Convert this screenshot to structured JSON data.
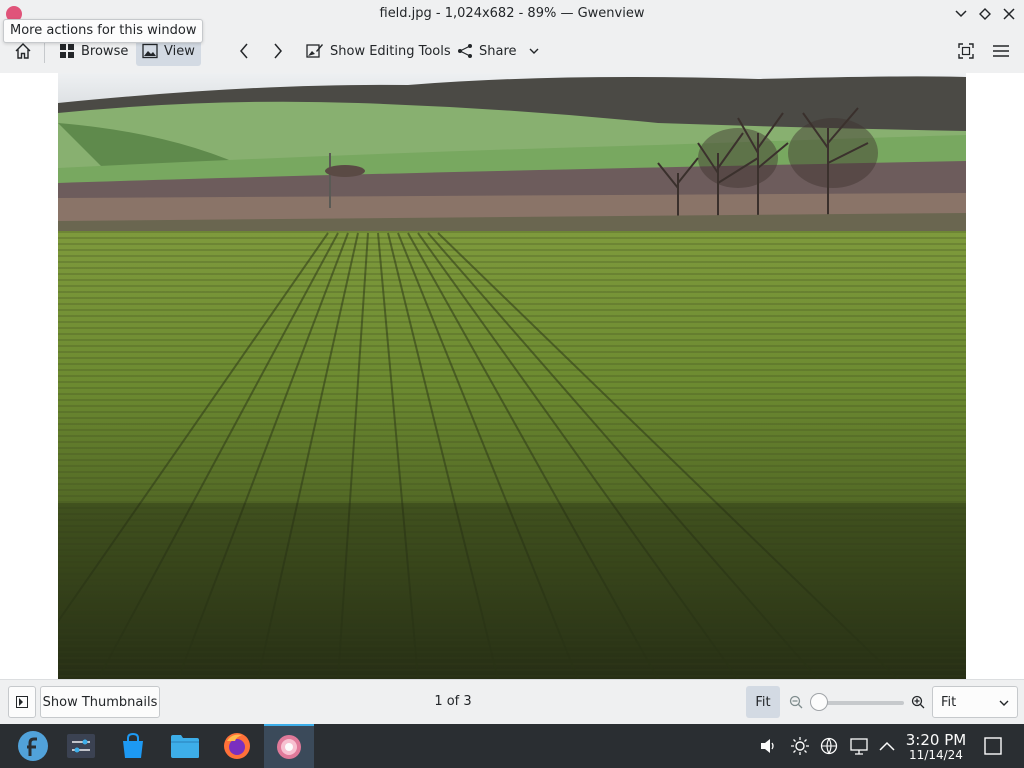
{
  "window": {
    "title": "field.jpg - 1,024x682 - 89% — Gwenview",
    "tooltip": "More actions for this window"
  },
  "toolbar": {
    "browse_label": "Browse",
    "view_label": "View",
    "editing_tools_label": "Show Editing Tools",
    "share_label": "Share"
  },
  "statusbar": {
    "thumbnails_label": "Show Thumbnails",
    "counter": "1 of 3",
    "fit_label": "Fit",
    "zoom_value": "Fit"
  },
  "taskbar": {
    "time": "3:20 PM",
    "date": "11/14/24"
  }
}
